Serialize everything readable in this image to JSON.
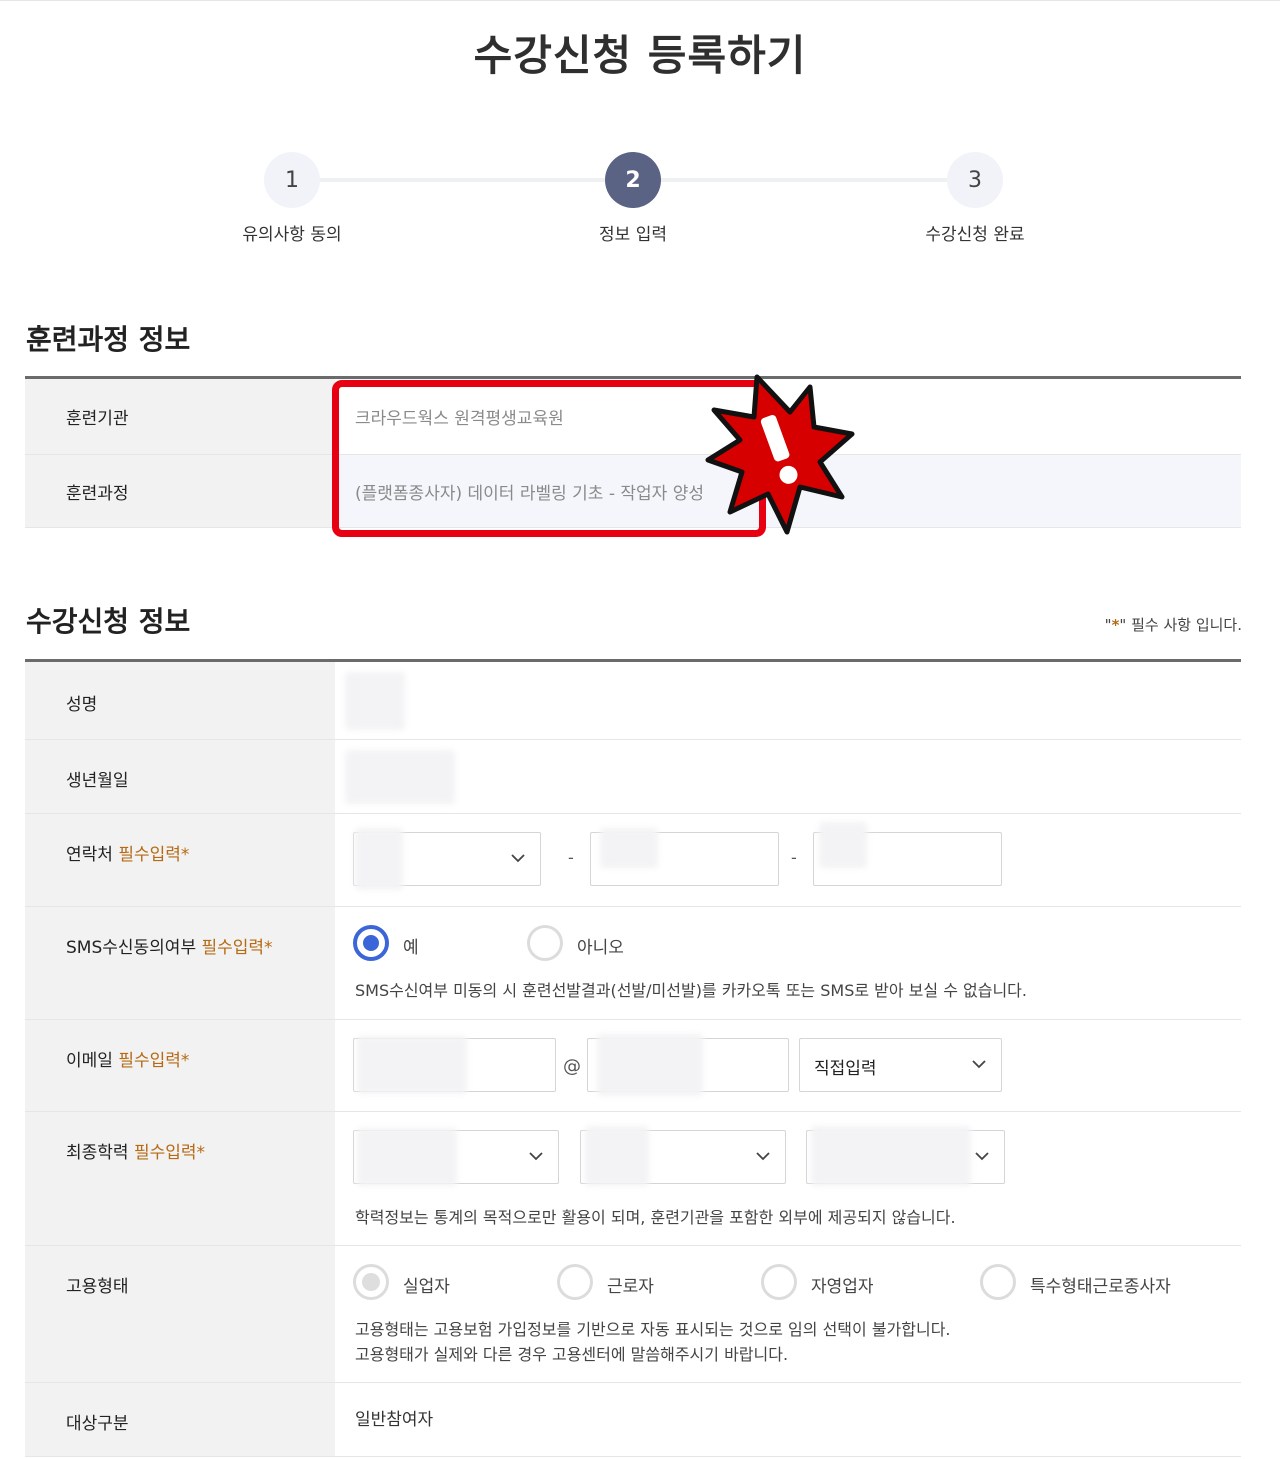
{
  "page": {
    "title": "수강신청 등록하기"
  },
  "stepper": {
    "steps": [
      {
        "number": "1",
        "label": "유의사항 동의"
      },
      {
        "number": "2",
        "label": "정보 입력"
      },
      {
        "number": "3",
        "label": "수강신청 완료"
      }
    ],
    "active_step": "2"
  },
  "course_info": {
    "title": "훈련과정 정보",
    "rows": [
      {
        "label": "훈련기관",
        "value": "크라우드웍스 원격평생교육원"
      },
      {
        "label": "훈련과정",
        "value": "(플랫폼종사자) 데이터 라벨링 기초 - 작업자 양성"
      }
    ]
  },
  "application_info": {
    "title": "수강신청 정보",
    "required_note_prefix": "\"",
    "required_note_star": "*",
    "required_note_suffix": "\" 필수 사항 입니다.",
    "required_tag": "필수입력*",
    "name": {
      "label": "성명"
    },
    "birth": {
      "label": "생년월일"
    },
    "phone": {
      "label": "연락처",
      "separator": "-"
    },
    "sms": {
      "label": "SMS수신동의여부",
      "options": [
        "예",
        "아니오"
      ],
      "selected": "예",
      "help": "SMS수신여부 미동의 시 훈련선발결과(선발/미선발)를 카카오톡 또는 SMS로 받아 보실 수 없습니다."
    },
    "email": {
      "label": "이메일",
      "at": "@",
      "domain_select": "직접입력"
    },
    "education": {
      "label": "최종학력",
      "help": "학력정보는 통계의 목적으로만 활용이 되며, 훈련기관을 포함한 외부에 제공되지 않습니다."
    },
    "employment": {
      "label": "고용형태",
      "options": [
        "실업자",
        "근로자",
        "자영업자",
        "특수형태근로종사자"
      ],
      "help_line1": "고용형태는 고용보험 가입정보를 기반으로 자동 표시되는 것으로 임의 선택이 불가합니다.",
      "help_line2": "고용형태가 실제와 다른 경우 고용센터에 말씀해주시기 바랍니다."
    },
    "target": {
      "label": "대상구분",
      "value": "일반참여자"
    }
  },
  "colors": {
    "accent": "#5a6384",
    "required": "#b66a14",
    "radio_on": "#3a66d8",
    "highlight": "#e60012"
  }
}
